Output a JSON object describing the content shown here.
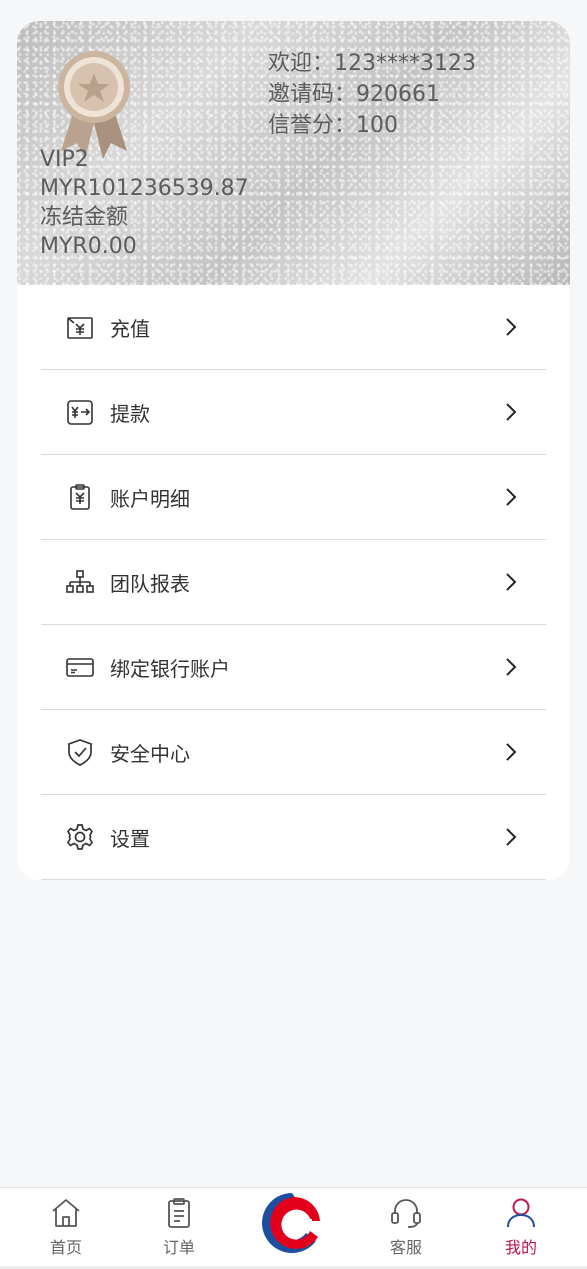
{
  "vip_card": {
    "level": "VIP2",
    "balance": "MYR101236539.87",
    "frozen_label": "冻结金额",
    "frozen_amount": "MYR0.00",
    "welcome_label": "欢迎：",
    "welcome_user": "123****3123",
    "invite_label": "邀请码：",
    "invite_code": "920661",
    "credit_label": "信誉分：",
    "credit_score": "100"
  },
  "menu": {
    "items": [
      {
        "label": "充值",
        "icon": "recharge-icon"
      },
      {
        "label": "提款",
        "icon": "withdraw-icon"
      },
      {
        "label": "账户明细",
        "icon": "account-detail-icon"
      },
      {
        "label": "团队报表",
        "icon": "team-report-icon"
      },
      {
        "label": "绑定银行账户",
        "icon": "bank-card-icon"
      },
      {
        "label": "安全中心",
        "icon": "shield-icon"
      },
      {
        "label": "设置",
        "icon": "gear-icon"
      }
    ]
  },
  "tabbar": {
    "home": "首页",
    "orders": "订单",
    "service": "客服",
    "mine": "我的",
    "active": "mine"
  },
  "colors": {
    "active_tab": "#c0154b",
    "logo_red": "#e2001a",
    "logo_blue": "#1d4fa0"
  }
}
